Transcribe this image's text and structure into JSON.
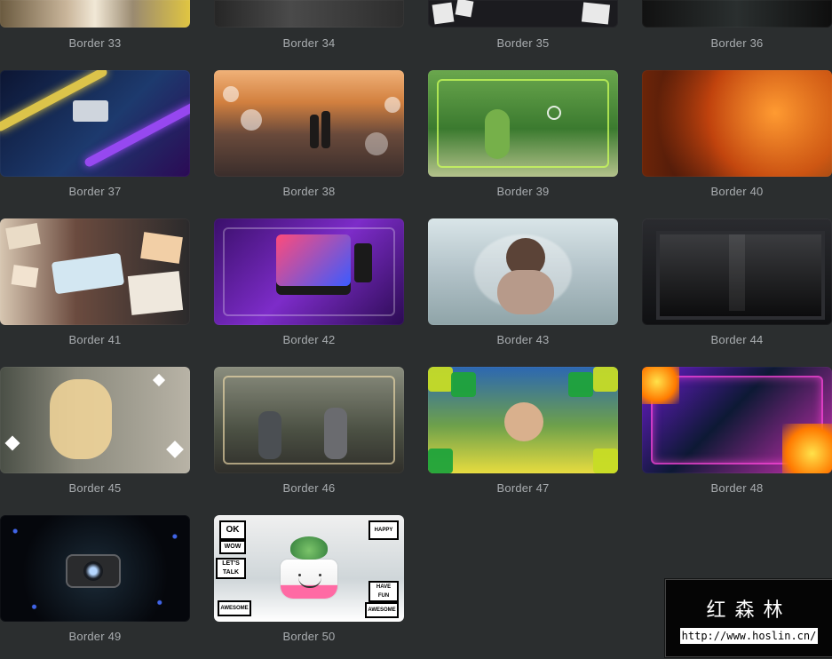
{
  "gallery": {
    "items": [
      {
        "label": "Border 33"
      },
      {
        "label": "Border 34"
      },
      {
        "label": "Border 35"
      },
      {
        "label": "Border 36"
      },
      {
        "label": "Border 37"
      },
      {
        "label": "Border 38"
      },
      {
        "label": "Border 39"
      },
      {
        "label": "Border 40"
      },
      {
        "label": "Border 41"
      },
      {
        "label": "Border 42"
      },
      {
        "label": "Border 43"
      },
      {
        "label": "Border 44"
      },
      {
        "label": "Border 45"
      },
      {
        "label": "Border 46"
      },
      {
        "label": "Border 47"
      },
      {
        "label": "Border 48"
      },
      {
        "label": "Border 49"
      },
      {
        "label": "Border 50"
      }
    ]
  },
  "thumb50": {
    "stickers": [
      "OK",
      "WOW",
      "LET'S TALK",
      "AWESOME",
      "HAPPY",
      "HAVE FUN",
      "AWESOME"
    ]
  },
  "watermark": {
    "title": "红森林",
    "url": "http://www.hoslin.cn/"
  }
}
